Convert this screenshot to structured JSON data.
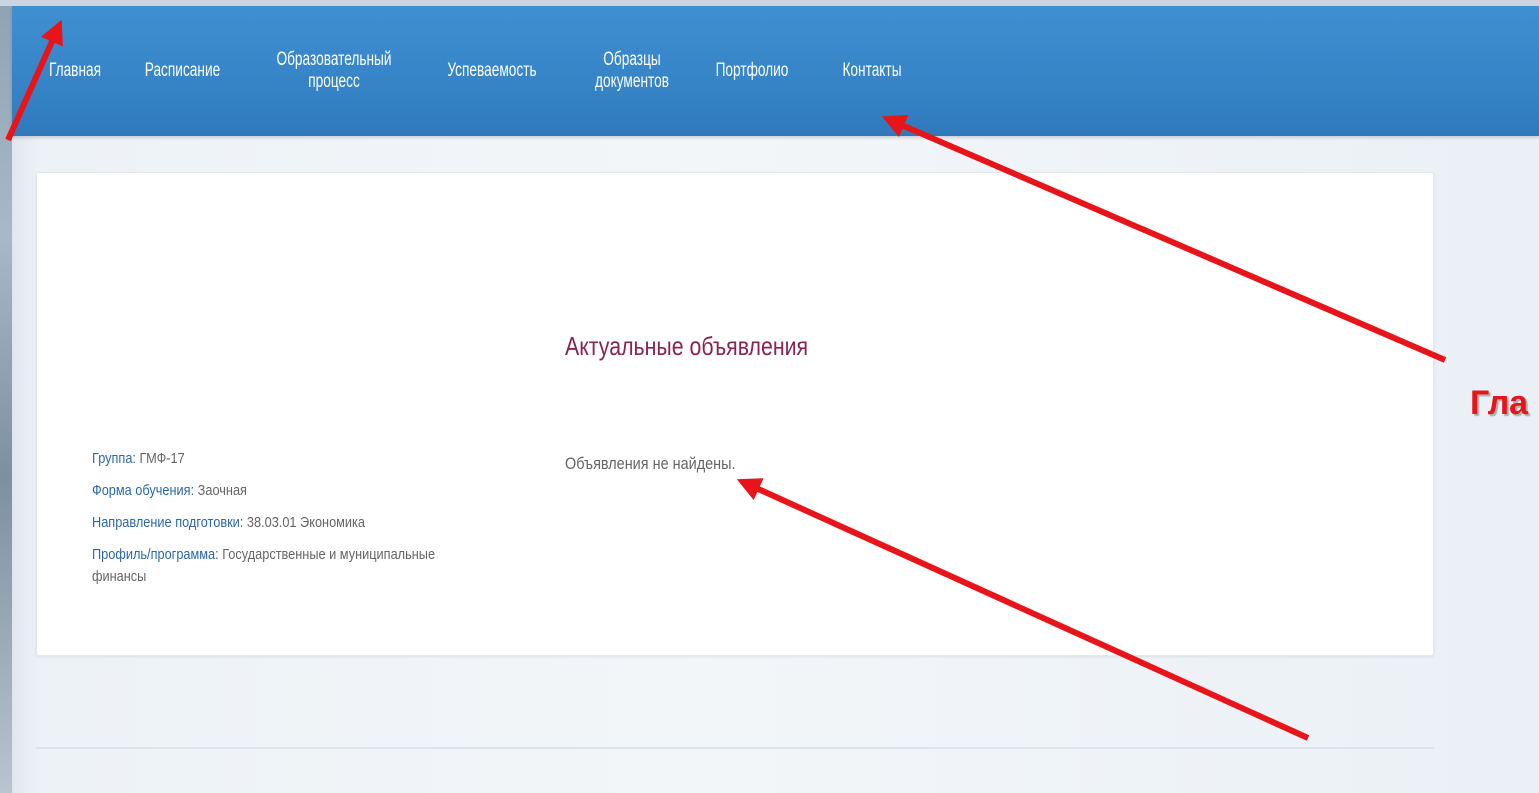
{
  "nav": {
    "items": [
      {
        "label": "Главная"
      },
      {
        "label": "Расписание"
      },
      {
        "label": "Образовательный процесс"
      },
      {
        "label": "Успеваемость"
      },
      {
        "label": "Образцы документов"
      },
      {
        "label": "Портфолио"
      },
      {
        "label": "Контакты"
      }
    ]
  },
  "student": {
    "group_label": "Группа:",
    "group_value": "ГМФ-17",
    "form_label": "Форма обучения:",
    "form_value": "Заочная",
    "direction_label": "Направление подготовки:",
    "direction_value": "38.03.01 Экономика",
    "profile_label": "Профиль/программа:",
    "profile_value": "Государственные и муниципальные финансы"
  },
  "announcements": {
    "title": "Актуальные объявления",
    "empty_message": "Объявления не найдены."
  },
  "overlay": {
    "right_label": "Гла",
    "arrow_color": "#e8141a"
  },
  "colors": {
    "nav_bg": "#3684c7",
    "title": "#8b2452",
    "label": "#2b69a8"
  }
}
